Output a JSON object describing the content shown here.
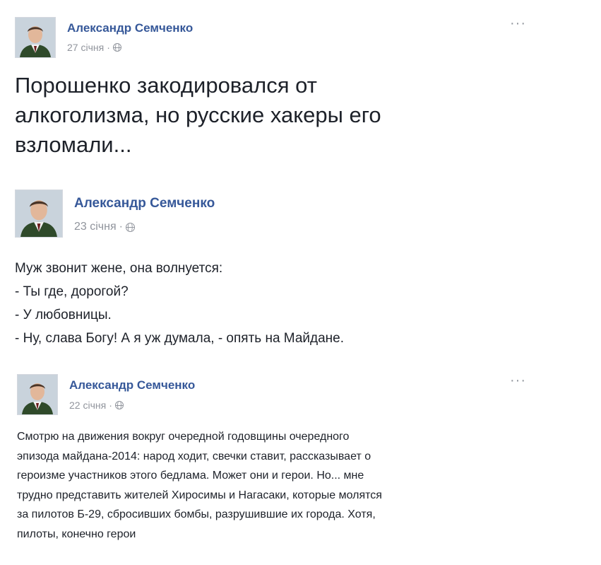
{
  "posts": [
    {
      "author": "Александр Семченко",
      "date": "27 січня",
      "separator": "·",
      "privacy_icon": "globe-icon",
      "more_label": "···",
      "text": "Порошенко закодировался от\nалкоголизма, но русские хакеры его\nвзломали..."
    },
    {
      "author": "Александр Семченко",
      "date": "23 січня",
      "separator": "·",
      "privacy_icon": "globe-icon",
      "text": "Муж звонит жене, она волнуется:\n- Ты где, дорогой?\n- У любовницы.\n- Ну, слава Богу! А я уж думала, - опять на Майдане."
    },
    {
      "author": "Александр Семченко",
      "date": "22 січня",
      "separator": "·",
      "privacy_icon": "globe-icon",
      "more_label": "···",
      "text": "Смотрю на движения вокруг очередной годовщины очередного\nэпизода майдана-2014: народ ходит, свечки ставит, рассказывает о\nгероизме участников этого бедлама. Может они и герои. Но... мне\nтрудно представить жителей Хиросимы и Нагасаки, которые молятся\nза пилотов Б-29, сбросивших бомбы, разрушившие их города. Хотя,\nпилоты, конечно герои"
    }
  ],
  "colors": {
    "author_link": "#365899",
    "meta_text": "#90949c",
    "body_text": "#1d2129"
  }
}
